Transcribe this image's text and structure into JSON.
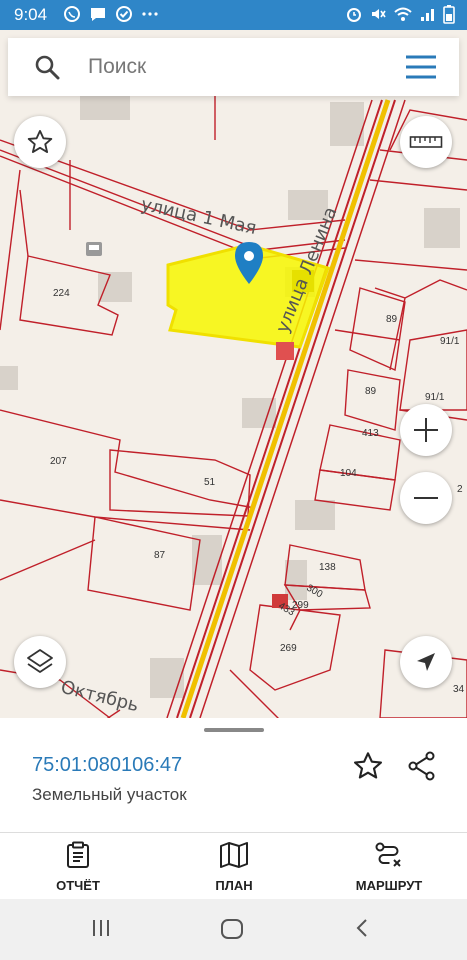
{
  "status": {
    "time": "9:04"
  },
  "search": {
    "placeholder": "Поиск"
  },
  "map": {
    "streets": {
      "may": "улица 1 Мая",
      "lenina": "улица Ленина",
      "oktyabrskaya": "Октябрь"
    },
    "parcels": [
      "224",
      "207",
      "51",
      "87",
      "89",
      "91/1",
      "89",
      "91/1",
      "413",
      "104",
      "138",
      "300",
      "299",
      "433",
      "269",
      "34",
      "2"
    ],
    "highlight_color": "#f7f700",
    "pin_color": "#1f7fc4"
  },
  "sheet": {
    "cadastral_number": "75:01:080106:47",
    "object_type": "Земельный участок"
  },
  "actions": {
    "report": "ОТЧЁТ",
    "plan": "ПЛАН",
    "route": "МАРШРУТ"
  },
  "colors": {
    "accent": "#2a7ab8",
    "status_bar": "#2f86c8",
    "road": "#f0c000",
    "boundary": "#c0202a"
  }
}
